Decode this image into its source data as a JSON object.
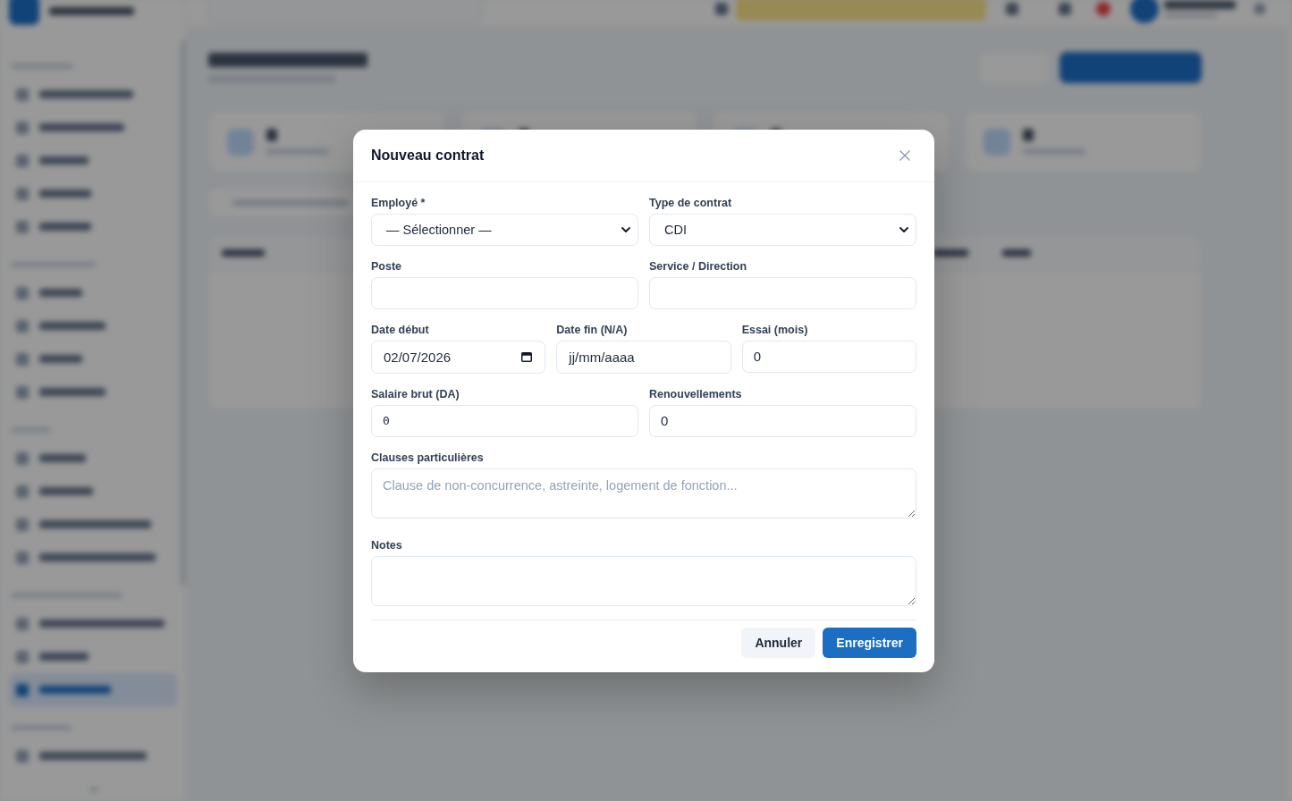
{
  "dialog": {
    "title": "Nouveau contrat",
    "rows": [
      {
        "fields": [
          {
            "label": "Employé *",
            "kind": "select",
            "value": "— Sélectionner —"
          },
          {
            "label": "Type de contrat",
            "kind": "select",
            "value": "CDI"
          }
        ]
      },
      {
        "fields": [
          {
            "label": "Poste",
            "kind": "text"
          },
          {
            "label": "Service / Direction",
            "kind": "text"
          }
        ]
      },
      {
        "fields": [
          {
            "label": "Date début",
            "kind": "date",
            "value": "02/07/2026",
            "picker": true
          },
          {
            "label": "Date fin (N/A)",
            "kind": "date",
            "placeholder": "jj/mm/aaaa",
            "picker": false
          },
          {
            "label": "Essai (mois)",
            "kind": "number",
            "value": "0"
          }
        ]
      },
      {
        "fields": [
          {
            "label": "Salaire brut (DA)",
            "kind": "amount",
            "value": "0"
          },
          {
            "label": "Renouvellements",
            "kind": "number",
            "value": "0"
          }
        ]
      },
      {
        "fields": [
          {
            "label": "Clauses particulières",
            "kind": "textarea",
            "placeholder": "Clause de non-concurrence, astreinte, logement de fonction..."
          }
        ]
      },
      {
        "fields": [
          {
            "label": "Notes",
            "kind": "textarea"
          }
        ]
      }
    ],
    "buttons": [
      {
        "label": "Annuler",
        "kind": "cancel"
      },
      {
        "label": "Enregistrer",
        "kind": "submit"
      }
    ]
  }
}
